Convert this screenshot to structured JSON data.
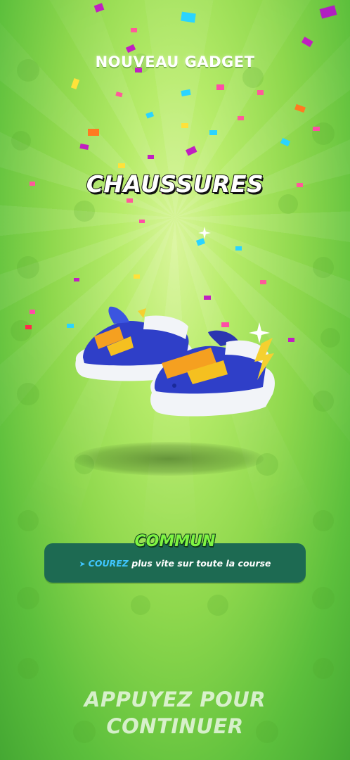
{
  "header": {
    "title": "NOUVEAU GADGET"
  },
  "gadget": {
    "name": "CHAUSSURES",
    "icon": "sneakers-icon",
    "rarity": "COMMUN",
    "description": {
      "arrow_icon": "chevron-right-icon",
      "keyword": "COUREZ",
      "text": "plus vite sur toute la course"
    }
  },
  "footer": {
    "line1": "APPUYEZ POUR",
    "line2": "CONTINUER"
  },
  "colors": {
    "background": "#8fd84d",
    "card": "#1d6a52",
    "rarity": "#7ef542",
    "keyword": "#3fc6ff",
    "shoe_body": "#2f3fc8",
    "shoe_strap": "#f5a020"
  }
}
